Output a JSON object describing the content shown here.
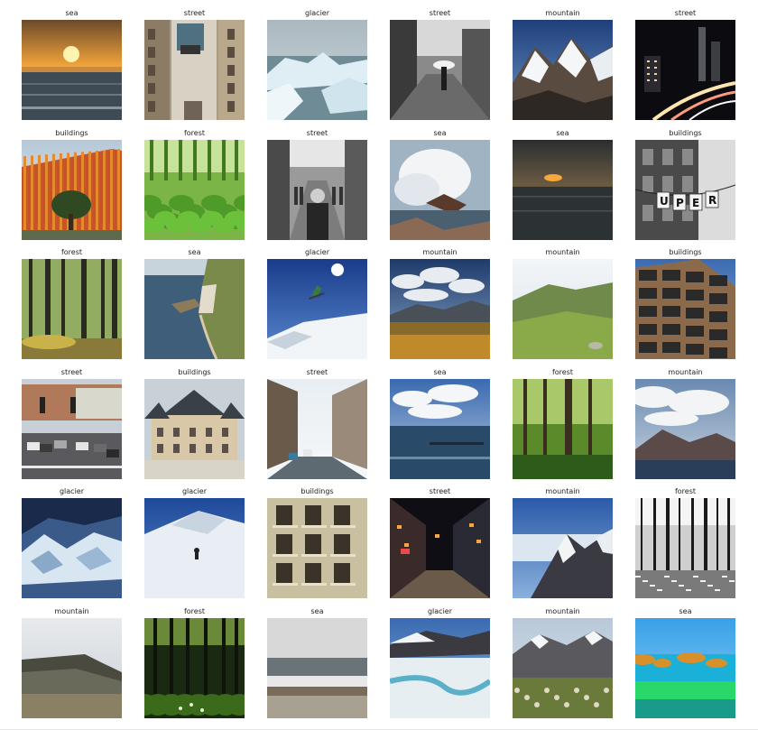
{
  "grid": {
    "title": "",
    "rows": [
      [
        {
          "label": "sea",
          "scene": "sea-sunset"
        },
        {
          "label": "street",
          "scene": "street-facade"
        },
        {
          "label": "glacier",
          "scene": "glacier-ice"
        },
        {
          "label": "street",
          "scene": "street-bw-umbrella"
        },
        {
          "label": "mountain",
          "scene": "mountain-snow-peaks"
        },
        {
          "label": "street",
          "scene": "street-night-lights"
        }
      ],
      [
        {
          "label": "buildings",
          "scene": "buildings-orange"
        },
        {
          "label": "forest",
          "scene": "forest-ferns"
        },
        {
          "label": "street",
          "scene": "street-bw-crowd"
        },
        {
          "label": "sea",
          "scene": "sea-wave-rocks"
        },
        {
          "label": "sea",
          "scene": "sea-dusk"
        },
        {
          "label": "buildings",
          "scene": "buildings-bw-banner"
        }
      ],
      [
        {
          "label": "forest",
          "scene": "forest-trunks"
        },
        {
          "label": "sea",
          "scene": "sea-cliffs"
        },
        {
          "label": "glacier",
          "scene": "glacier-skier-jump"
        },
        {
          "label": "mountain",
          "scene": "mountain-clouds-field"
        },
        {
          "label": "mountain",
          "scene": "mountain-green-hills"
        },
        {
          "label": "buildings",
          "scene": "buildings-modern"
        }
      ],
      [
        {
          "label": "street",
          "scene": "street-traffic"
        },
        {
          "label": "buildings",
          "scene": "buildings-chateau"
        },
        {
          "label": "street",
          "scene": "street-city"
        },
        {
          "label": "sea",
          "scene": "sea-blue-sky"
        },
        {
          "label": "forest",
          "scene": "forest-green"
        },
        {
          "label": "mountain",
          "scene": "mountain-lake-clouds"
        }
      ],
      [
        {
          "label": "glacier",
          "scene": "glacier-blue"
        },
        {
          "label": "glacier",
          "scene": "glacier-skier-slope"
        },
        {
          "label": "buildings",
          "scene": "buildings-classic"
        },
        {
          "label": "street",
          "scene": "street-night-alley"
        },
        {
          "label": "mountain",
          "scene": "mountain-above-clouds"
        },
        {
          "label": "forest",
          "scene": "forest-bw"
        }
      ],
      [
        {
          "label": "mountain",
          "scene": "mountain-plateau"
        },
        {
          "label": "forest",
          "scene": "forest-dark"
        },
        {
          "label": "sea",
          "scene": "sea-grey-surf"
        },
        {
          "label": "glacier",
          "scene": "glacier-river"
        },
        {
          "label": "mountain",
          "scene": "mountain-range-meadow"
        },
        {
          "label": "sea",
          "scene": "sea-turquoise-rocks"
        }
      ]
    ]
  }
}
